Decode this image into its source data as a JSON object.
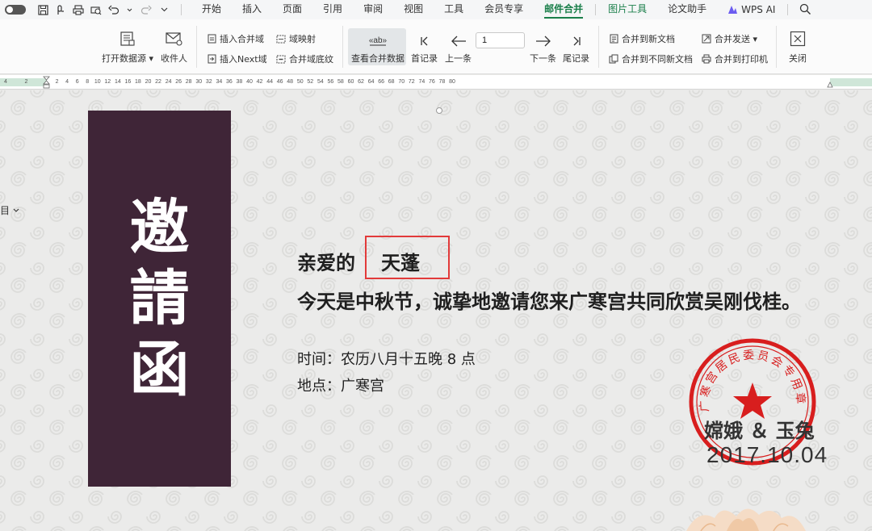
{
  "menubar": {
    "tabs": [
      {
        "label": "开始"
      },
      {
        "label": "插入"
      },
      {
        "label": "页面"
      },
      {
        "label": "引用"
      },
      {
        "label": "审阅"
      },
      {
        "label": "视图"
      },
      {
        "label": "工具"
      },
      {
        "label": "会员专享"
      },
      {
        "label": "邮件合并"
      },
      {
        "label": "图片工具"
      },
      {
        "label": "论文助手"
      },
      {
        "label": "WPS AI"
      }
    ],
    "active_tab": "邮件合并"
  },
  "ribbon": {
    "open_datasource": "打开数据源",
    "recipients": "收件人",
    "insert_merge_field": "插入合并域",
    "insert_next_field": "插入Next域",
    "field_mapping": "域映射",
    "merge_field_shading": "合并域底纹",
    "view_merged_data": "查看合并数据",
    "first_record": "首记录",
    "prev_record": "上一条",
    "record_number": "1",
    "next_record": "下一条",
    "last_record": "尾记录",
    "merge_to_new_doc": "合并到新文档",
    "merge_to_separate_docs": "合并到不同新文档",
    "merge_send": "合并发送",
    "merge_to_printer": "合并到打印机",
    "close": "关闭"
  },
  "ruler": {
    "ticks": [
      "4",
      "2",
      "2",
      "4",
      "6",
      "8",
      "10",
      "12",
      "14",
      "16",
      "18",
      "20",
      "22",
      "24",
      "26",
      "28",
      "30",
      "32",
      "34",
      "36",
      "38",
      "40",
      "42",
      "44",
      "46",
      "48",
      "50",
      "52",
      "54",
      "56",
      "58",
      "60",
      "62",
      "64",
      "66",
      "68",
      "70",
      "72",
      "74",
      "76",
      "78",
      "80"
    ]
  },
  "document": {
    "banner_chars": [
      "邀",
      "請",
      "函"
    ],
    "greeting": "亲爱的",
    "recipient_name": "天蓬",
    "invitation": "今天是中秋节，诚挚地邀请您来广寒宫共同欣赏吴刚伐桂。",
    "time_line": "时间：农历八月十五晚 8 点",
    "place_line": "地点：广寒宫",
    "signature": "嫦娥 ＆ 玉兔",
    "date": "2017.10.04",
    "seal_text": "广寒宫居民委员会专用章",
    "side_widget": "目"
  },
  "colors": {
    "accent_green": "#1a7f4a",
    "banner_purple": "#3f2537",
    "highlight_red": "#e23a3a",
    "seal_red": "#d81e1e"
  }
}
